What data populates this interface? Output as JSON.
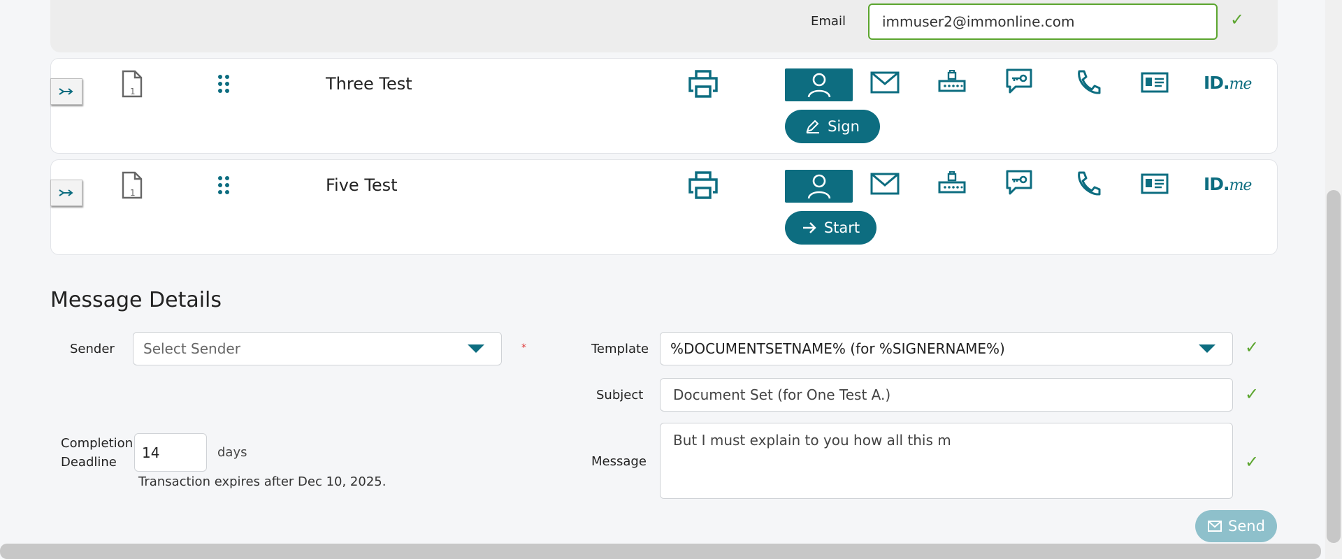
{
  "email_section": {
    "label": "Email",
    "value": "immuser2@immonline.com"
  },
  "signers": [
    {
      "name": "Three Test",
      "action_label": "Sign",
      "action_icon": "pen-icon",
      "page_badge": "1"
    },
    {
      "name": "Five Test",
      "action_label": "Start",
      "action_icon": "arrow-right-icon",
      "page_badge": "1"
    }
  ],
  "auth_methods": [
    "person-icon",
    "envelope-icon",
    "password-lock-icon",
    "sms-key-icon",
    "phone-icon",
    "id-card-icon",
    "idme-logo"
  ],
  "idme": {
    "id": "ID.",
    "me": "me"
  },
  "message_details": {
    "title": "Message Details",
    "sender_label": "Sender",
    "sender_placeholder": "Select Sender",
    "required_marker": "*",
    "template_label": "Template",
    "template_value": "%DOCUMENTSETNAME% (for %SIGNERNAME%)",
    "subject_label": "Subject",
    "subject_value": "Document Set (for One Test A.)",
    "message_label": "Message",
    "message_value": "But I must explain to you how all this m",
    "deadline_label_1": "Completion",
    "deadline_label_2": "Deadline",
    "deadline_value": "14",
    "deadline_unit": "days",
    "expiry_note": "Transaction expires after Dec 10, 2025."
  },
  "send_label": "Send",
  "colors": {
    "primary": "#0d6d80",
    "success": "#5ba52e",
    "send_disabled": "#8ec0cb"
  }
}
